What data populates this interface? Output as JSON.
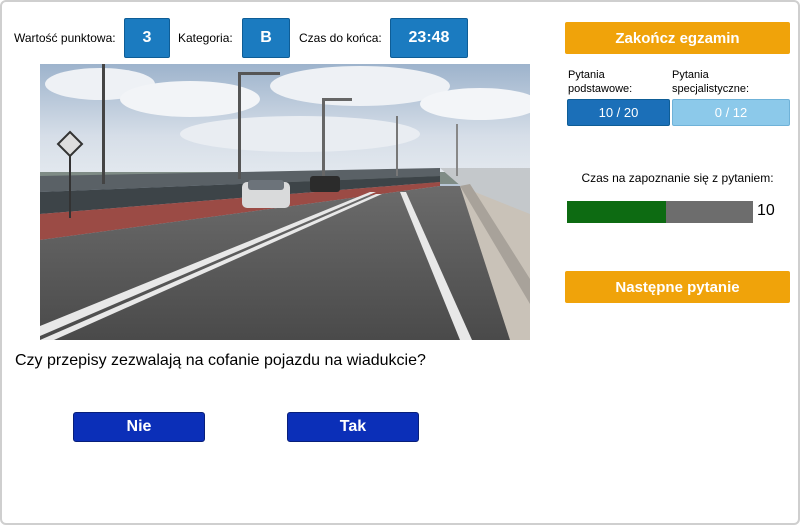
{
  "header": {
    "points_label": "Wartość punktowa:",
    "points_value": "3",
    "category_label": "Kategoria:",
    "category_value": "B",
    "time_label": "Czas do końca:",
    "time_value": "23:48"
  },
  "question": {
    "text": "Czy przepisy zezwalają na cofanie pojazdu na wiadukcie?",
    "answers": [
      "Nie",
      "Tak"
    ]
  },
  "sidebar": {
    "end_exam_label": "Zakończ egzamin",
    "basic_label_line1": "Pytania",
    "basic_label_line2": "podstawowe:",
    "specialist_label_line1": "Pytania",
    "specialist_label_line2": "specjalistyczne:",
    "basic_progress": "10 / 20",
    "specialist_progress": "0 / 12",
    "reading_time_label": "Czas na zapoznanie się z pytaniem:",
    "reading_time_value": "10",
    "reading_time_fraction": 0.53,
    "next_question_label": "Następne pytanie"
  },
  "colors": {
    "header_box": "#1b7bc0",
    "answer_button": "#0b2fb8",
    "orange_button": "#f0a30a",
    "basic_active": "#1b6fb8",
    "specialist_inactive": "#8cc9ea",
    "timer_fill": "#0d6b12",
    "timer_track": "#6d6d6d"
  }
}
